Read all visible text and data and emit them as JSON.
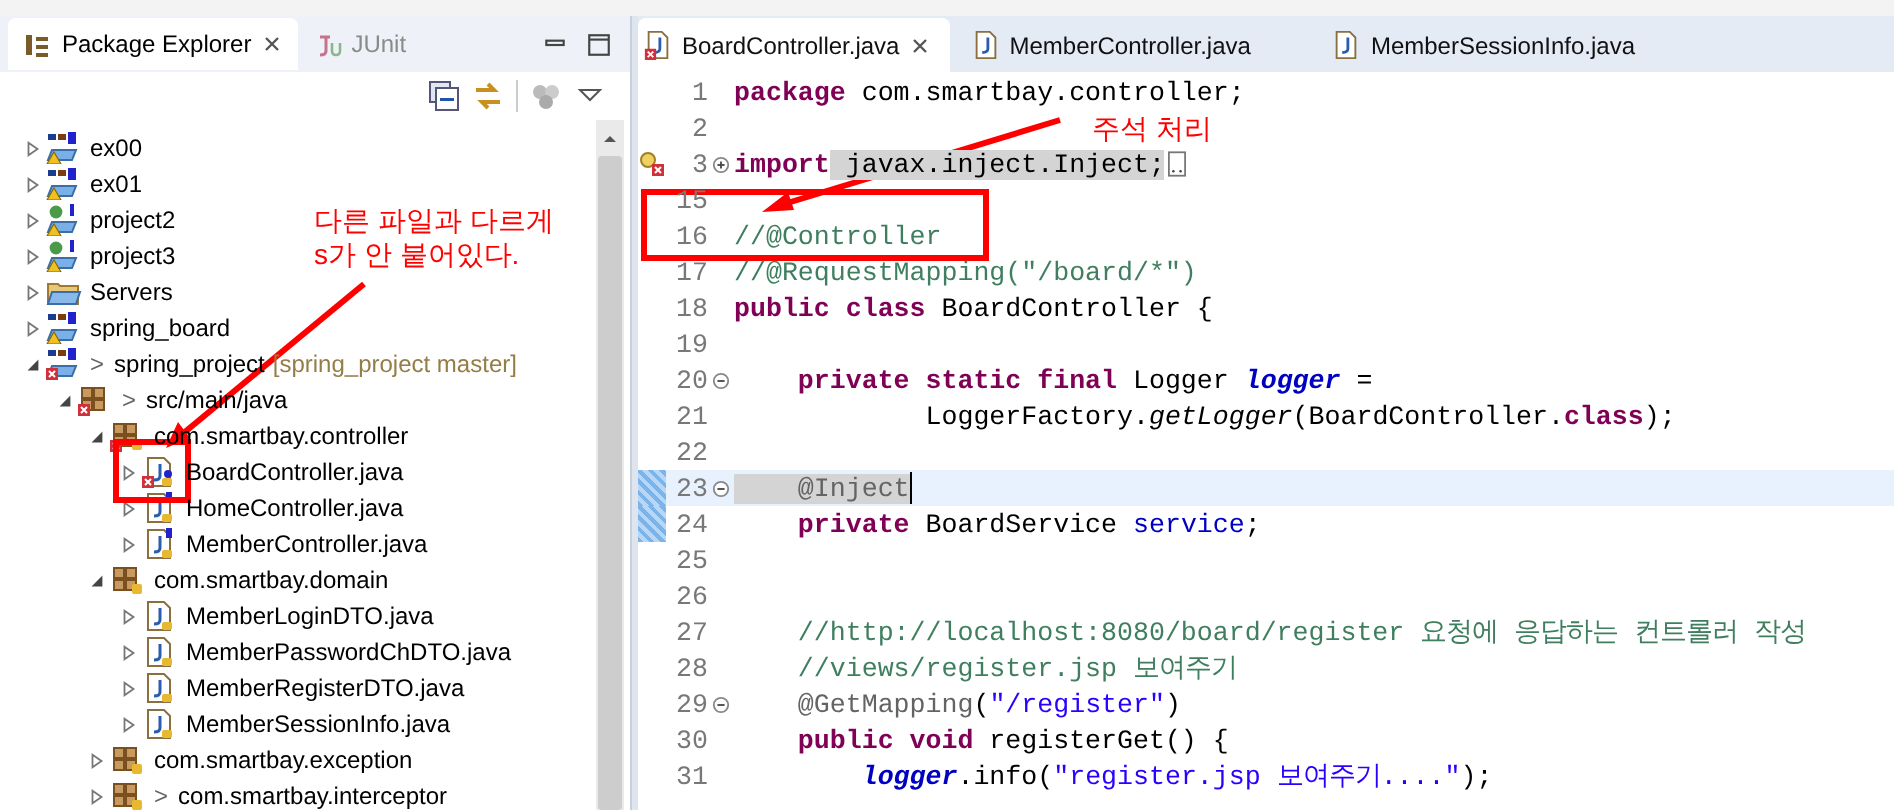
{
  "package_explorer": {
    "tabs": [
      {
        "label": "Package Explorer",
        "selected": true,
        "kind": "explorer"
      },
      {
        "label": "JUnit",
        "selected": false,
        "kind": "junit"
      }
    ],
    "tree": [
      {
        "label": "ex00",
        "kind": "maven-project",
        "expanded": false,
        "warning": true
      },
      {
        "label": "ex01",
        "kind": "maven-project",
        "expanded": false,
        "warning": true
      },
      {
        "label": "project2",
        "kind": "web-project",
        "expanded": false,
        "warning": true
      },
      {
        "label": "project3",
        "kind": "web-project",
        "expanded": false,
        "warning": true
      },
      {
        "label": "Servers",
        "kind": "folder",
        "expanded": false
      },
      {
        "label": "spring_board",
        "kind": "maven-project",
        "expanded": false,
        "warning": true
      },
      {
        "label": "spring_project",
        "kind": "maven-project",
        "expanded": true,
        "error": true,
        "dirty": ">",
        "branch": "[spring_project master]",
        "children": [
          {
            "label": "src/main/java",
            "kind": "source-folder",
            "expanded": true,
            "error": true,
            "dirty": ">",
            "children": [
              {
                "label": "com.smartbay.controller",
                "kind": "package",
                "expanded": true,
                "error": true,
                "children": [
                  {
                    "label": "BoardController.java",
                    "kind": "java-file",
                    "expanded": false,
                    "error": true,
                    "unresolved": true
                  },
                  {
                    "label": "HomeController.java",
                    "kind": "java-file",
                    "expanded": false,
                    "spring": true
                  },
                  {
                    "label": "MemberController.java",
                    "kind": "java-file",
                    "expanded": false,
                    "spring": true
                  }
                ]
              },
              {
                "label": "com.smartbay.domain",
                "kind": "package",
                "expanded": true,
                "children": [
                  {
                    "label": "MemberLoginDTO.java",
                    "kind": "java-file",
                    "expanded": false
                  },
                  {
                    "label": "MemberPasswordChDTO.java",
                    "kind": "java-file",
                    "expanded": false
                  },
                  {
                    "label": "MemberRegisterDTO.java",
                    "kind": "java-file",
                    "expanded": false
                  },
                  {
                    "label": "MemberSessionInfo.java",
                    "kind": "java-file",
                    "expanded": false
                  }
                ]
              },
              {
                "label": "com.smartbay.exception",
                "kind": "package",
                "expanded": false
              },
              {
                "label": "com.smartbay.interceptor",
                "kind": "package",
                "expanded": false,
                "dirty": ">"
              }
            ]
          }
        ]
      }
    ]
  },
  "editor": {
    "tabs": [
      {
        "label": "BoardController.java",
        "selected": true,
        "error": true
      },
      {
        "label": "MemberController.java",
        "selected": false
      },
      {
        "label": "MemberSessionInfo.java",
        "selected": false
      }
    ],
    "lines": [
      {
        "number": "1",
        "tokens": [
          {
            "kind": "keyword",
            "text": "package"
          },
          {
            "kind": "plain",
            "text": " com.smartbay.controller;"
          }
        ]
      },
      {
        "number": "2"
      },
      {
        "number": "3",
        "error": true,
        "fold_expanded": false,
        "folded": true,
        "tokens": [
          {
            "kind": "keyword",
            "text": "import"
          },
          {
            "kind": "occurrence",
            "text": " javax.inject.Inject;"
          }
        ]
      },
      {
        "number": "15"
      },
      {
        "number": "16",
        "tokens": [
          {
            "kind": "comment",
            "text": "//@Controller"
          }
        ]
      },
      {
        "number": "17",
        "tokens": [
          {
            "kind": "comment",
            "text": "//@RequestMapping(\"/board/*\")"
          }
        ]
      },
      {
        "number": "18",
        "tokens": [
          {
            "kind": "keyword",
            "text": "public class"
          },
          {
            "kind": "plain",
            "text": " BoardController {"
          }
        ]
      },
      {
        "number": "19"
      },
      {
        "number": "20",
        "fold_expanded": true,
        "tokens": [
          {
            "kind": "keyword",
            "text": "    private static final"
          },
          {
            "kind": "plain",
            "text": " Logger "
          },
          {
            "kind": "static-field",
            "text": "logger"
          },
          {
            "kind": "plain",
            "text": " ="
          }
        ]
      },
      {
        "number": "21",
        "tokens": [
          {
            "kind": "plain",
            "text": "            LoggerFactory."
          },
          {
            "kind": "static-method",
            "text": "getLogger"
          },
          {
            "kind": "plain",
            "text": "(BoardController."
          },
          {
            "kind": "keyword",
            "text": "class"
          },
          {
            "kind": "plain",
            "text": ");"
          }
        ]
      },
      {
        "number": "22"
      },
      {
        "number": "23",
        "changed": true,
        "fold_expanded": true,
        "current": true,
        "caret": true,
        "tokens": [
          {
            "kind": "annotation-occurrence",
            "text": "    @Inject"
          }
        ]
      },
      {
        "number": "24",
        "changed": true,
        "tokens": [
          {
            "kind": "keyword",
            "text": "    private"
          },
          {
            "kind": "plain",
            "text": " BoardService "
          },
          {
            "kind": "field",
            "text": "service"
          },
          {
            "kind": "plain",
            "text": ";"
          }
        ]
      },
      {
        "number": "25"
      },
      {
        "number": "26"
      },
      {
        "number": "27",
        "tokens": [
          {
            "kind": "comment",
            "text": "    //http://localhost:8080/board/register 요청에 응답하는 컨트롤러 작성"
          }
        ]
      },
      {
        "number": "28",
        "tokens": [
          {
            "kind": "comment",
            "text": "    //views/register.jsp 보여주기"
          }
        ]
      },
      {
        "number": "29",
        "fold_expanded": true,
        "tokens": [
          {
            "kind": "annotation",
            "text": "    @GetMapping"
          },
          {
            "kind": "plain",
            "text": "("
          },
          {
            "kind": "string",
            "text": "\"/register\""
          },
          {
            "kind": "plain",
            "text": ")"
          }
        ]
      },
      {
        "number": "30",
        "tokens": [
          {
            "kind": "keyword",
            "text": "    public void"
          },
          {
            "kind": "plain",
            "text": " registerGet() {"
          }
        ]
      },
      {
        "number": "31",
        "tokens": [
          {
            "kind": "static-field",
            "text": "        logger"
          },
          {
            "kind": "plain",
            "text": ".info("
          },
          {
            "kind": "string",
            "text": "\"register.jsp 보여주기....\""
          },
          {
            "kind": "plain",
            "text": ");"
          }
        ]
      }
    ]
  },
  "annotations": [
    {
      "lines": [
        "다른 파일과 다르게",
        "s가 안 붙어있다."
      ]
    },
    {
      "lines": [
        "주석 처리"
      ]
    }
  ]
}
